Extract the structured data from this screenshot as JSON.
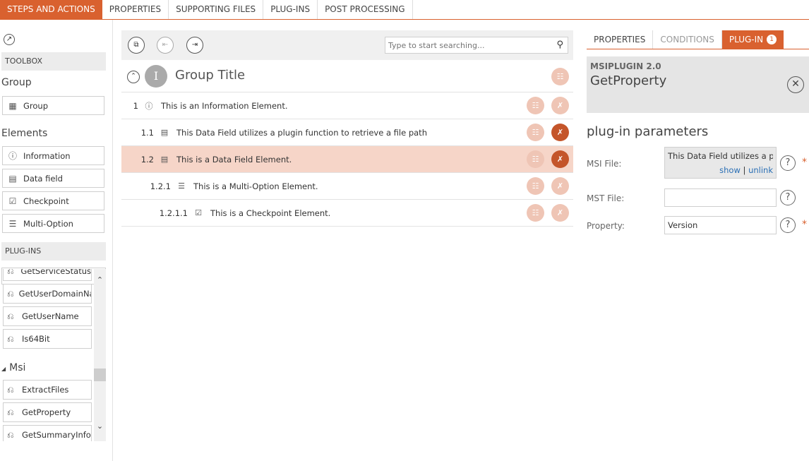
{
  "top_tabs": [
    "STEPS AND ACTIONS",
    "PROPERTIES",
    "SUPPORTING FILES",
    "PLUG-INS",
    "POST PROCESSING"
  ],
  "toolbox": {
    "header": "TOOLBOX",
    "group_heading": "Group",
    "group_item": "Group",
    "elements_heading": "Elements",
    "elements": [
      "Information",
      "Data field",
      "Checkpoint",
      "Multi-Option"
    ]
  },
  "plugins": {
    "header": "PLUG-INS",
    "search_placeholder": "Type to start searchi...",
    "items": [
      "GetServiceStatus",
      "GetUserDomainNa",
      "GetUserName",
      "Is64Bit"
    ],
    "msi_group": "Msi",
    "msi_items": [
      "ExtractFiles",
      "GetProperty",
      "GetSummaryInfo"
    ]
  },
  "center": {
    "search_placeholder": "Type to start searching...",
    "group": {
      "numeral": "I",
      "title": "Group Title"
    },
    "rows": [
      {
        "num": "1",
        "icon": "info-icon",
        "text": "This is an Information Element."
      },
      {
        "num": "1.1",
        "icon": "datafield-icon",
        "text": "This Data Field utilizes a plugin function to retrieve a file path"
      },
      {
        "num": "1.2",
        "icon": "datafield-icon",
        "text": "This is a Data Field Element."
      },
      {
        "num": "1.2.1",
        "icon": "multioption-icon",
        "text": "This is a Multi-Option Element."
      },
      {
        "num": "1.2.1.1",
        "icon": "checkpoint-icon",
        "text": "This is a Checkpoint Element."
      }
    ]
  },
  "right": {
    "tabs": [
      "PROPERTIES",
      "CONDITIONS",
      "PLUG-IN"
    ],
    "plugin_badge": "1",
    "plugin_name": "MSIPLUGIN 2.0",
    "function_name": "GetProperty",
    "params_title": "plug-in parameters",
    "msi_label": "MSI File:",
    "msi_value": "This Data Field utilizes a pl...",
    "show_link": "show",
    "separator": "|",
    "unlink_link": "unlink",
    "mst_label": "MST File:",
    "mst_value": "",
    "property_label": "Property:",
    "property_value": "Version",
    "help_glyph": "?",
    "required_glyph": "*"
  },
  "colors": {
    "accent": "#d9612f",
    "selected_row": "#f6d5c8",
    "action_light": "#efc5b5",
    "action_dark": "#c4552a"
  }
}
